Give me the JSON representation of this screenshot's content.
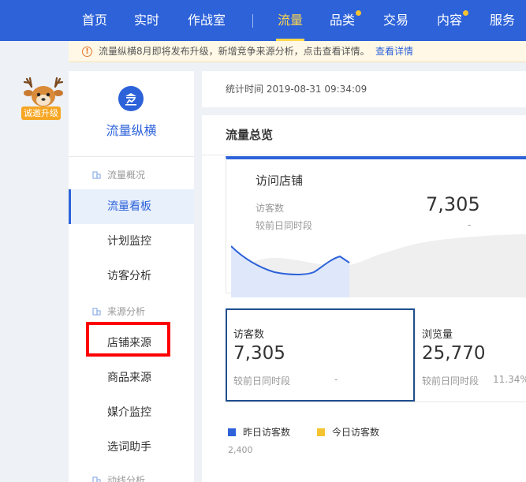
{
  "nav": {
    "items": [
      {
        "label": "首页",
        "active": false,
        "dot": false
      },
      {
        "label": "实时",
        "active": false,
        "dot": false
      },
      {
        "label": "作战室",
        "active": false,
        "dot": false
      },
      {
        "label": "流量",
        "active": true,
        "dot": false
      },
      {
        "label": "品类",
        "active": false,
        "dot": true
      },
      {
        "label": "交易",
        "active": false,
        "dot": false
      },
      {
        "label": "内容",
        "active": false,
        "dot": true
      },
      {
        "label": "服务",
        "active": false,
        "dot": false
      }
    ]
  },
  "notice": {
    "icon": "warning-icon",
    "text": "流量纵横8月即将发布升级，新增竞争来源分析，点击查看详情。",
    "link": "查看详情"
  },
  "mascot": {
    "icon": "deer-mascot-icon",
    "badge": "诚邀升级"
  },
  "sidebar": {
    "logo_icon": "chart-building-icon",
    "title": "流量纵横",
    "groups": [
      {
        "label": "流量概况"
      },
      {
        "label": "来源分析"
      },
      {
        "label": "动线分析"
      }
    ],
    "items": [
      {
        "label": "流量看板",
        "active": true
      },
      {
        "label": "计划监控",
        "active": false
      },
      {
        "label": "访客分析",
        "active": false
      },
      {
        "label": "店铺来源",
        "active": false
      },
      {
        "label": "商品来源",
        "active": false
      },
      {
        "label": "媒介监控",
        "active": false
      },
      {
        "label": "选词助手",
        "active": false
      }
    ]
  },
  "main": {
    "stat_time": "统计时间 2019-08-31 09:34:09",
    "panel_title": "流量总览",
    "overview": {
      "title": "访问店铺",
      "visitors_label": "访客数",
      "compare_label": "较前日同时段",
      "visitors_value": "7,305",
      "compare_value": "-"
    },
    "metrics": [
      {
        "label": "访客数",
        "value": "7,305",
        "compare_label": "较前日同时段",
        "compare_value": "-",
        "selected": true
      },
      {
        "label": "浏览量",
        "value": "25,770",
        "compare_label": "较前日同时段",
        "compare_value": "11.34%",
        "selected": false
      }
    ],
    "legend": [
      {
        "label": "昨日访客数",
        "color": "#2d62d9"
      },
      {
        "label": "今日访客数",
        "color": "#f4c430"
      }
    ],
    "axis_tick": "2,400"
  },
  "colors": {
    "brand": "#2d62d9",
    "nav_active": "#ffd84d",
    "highlight": "#ff0000"
  }
}
